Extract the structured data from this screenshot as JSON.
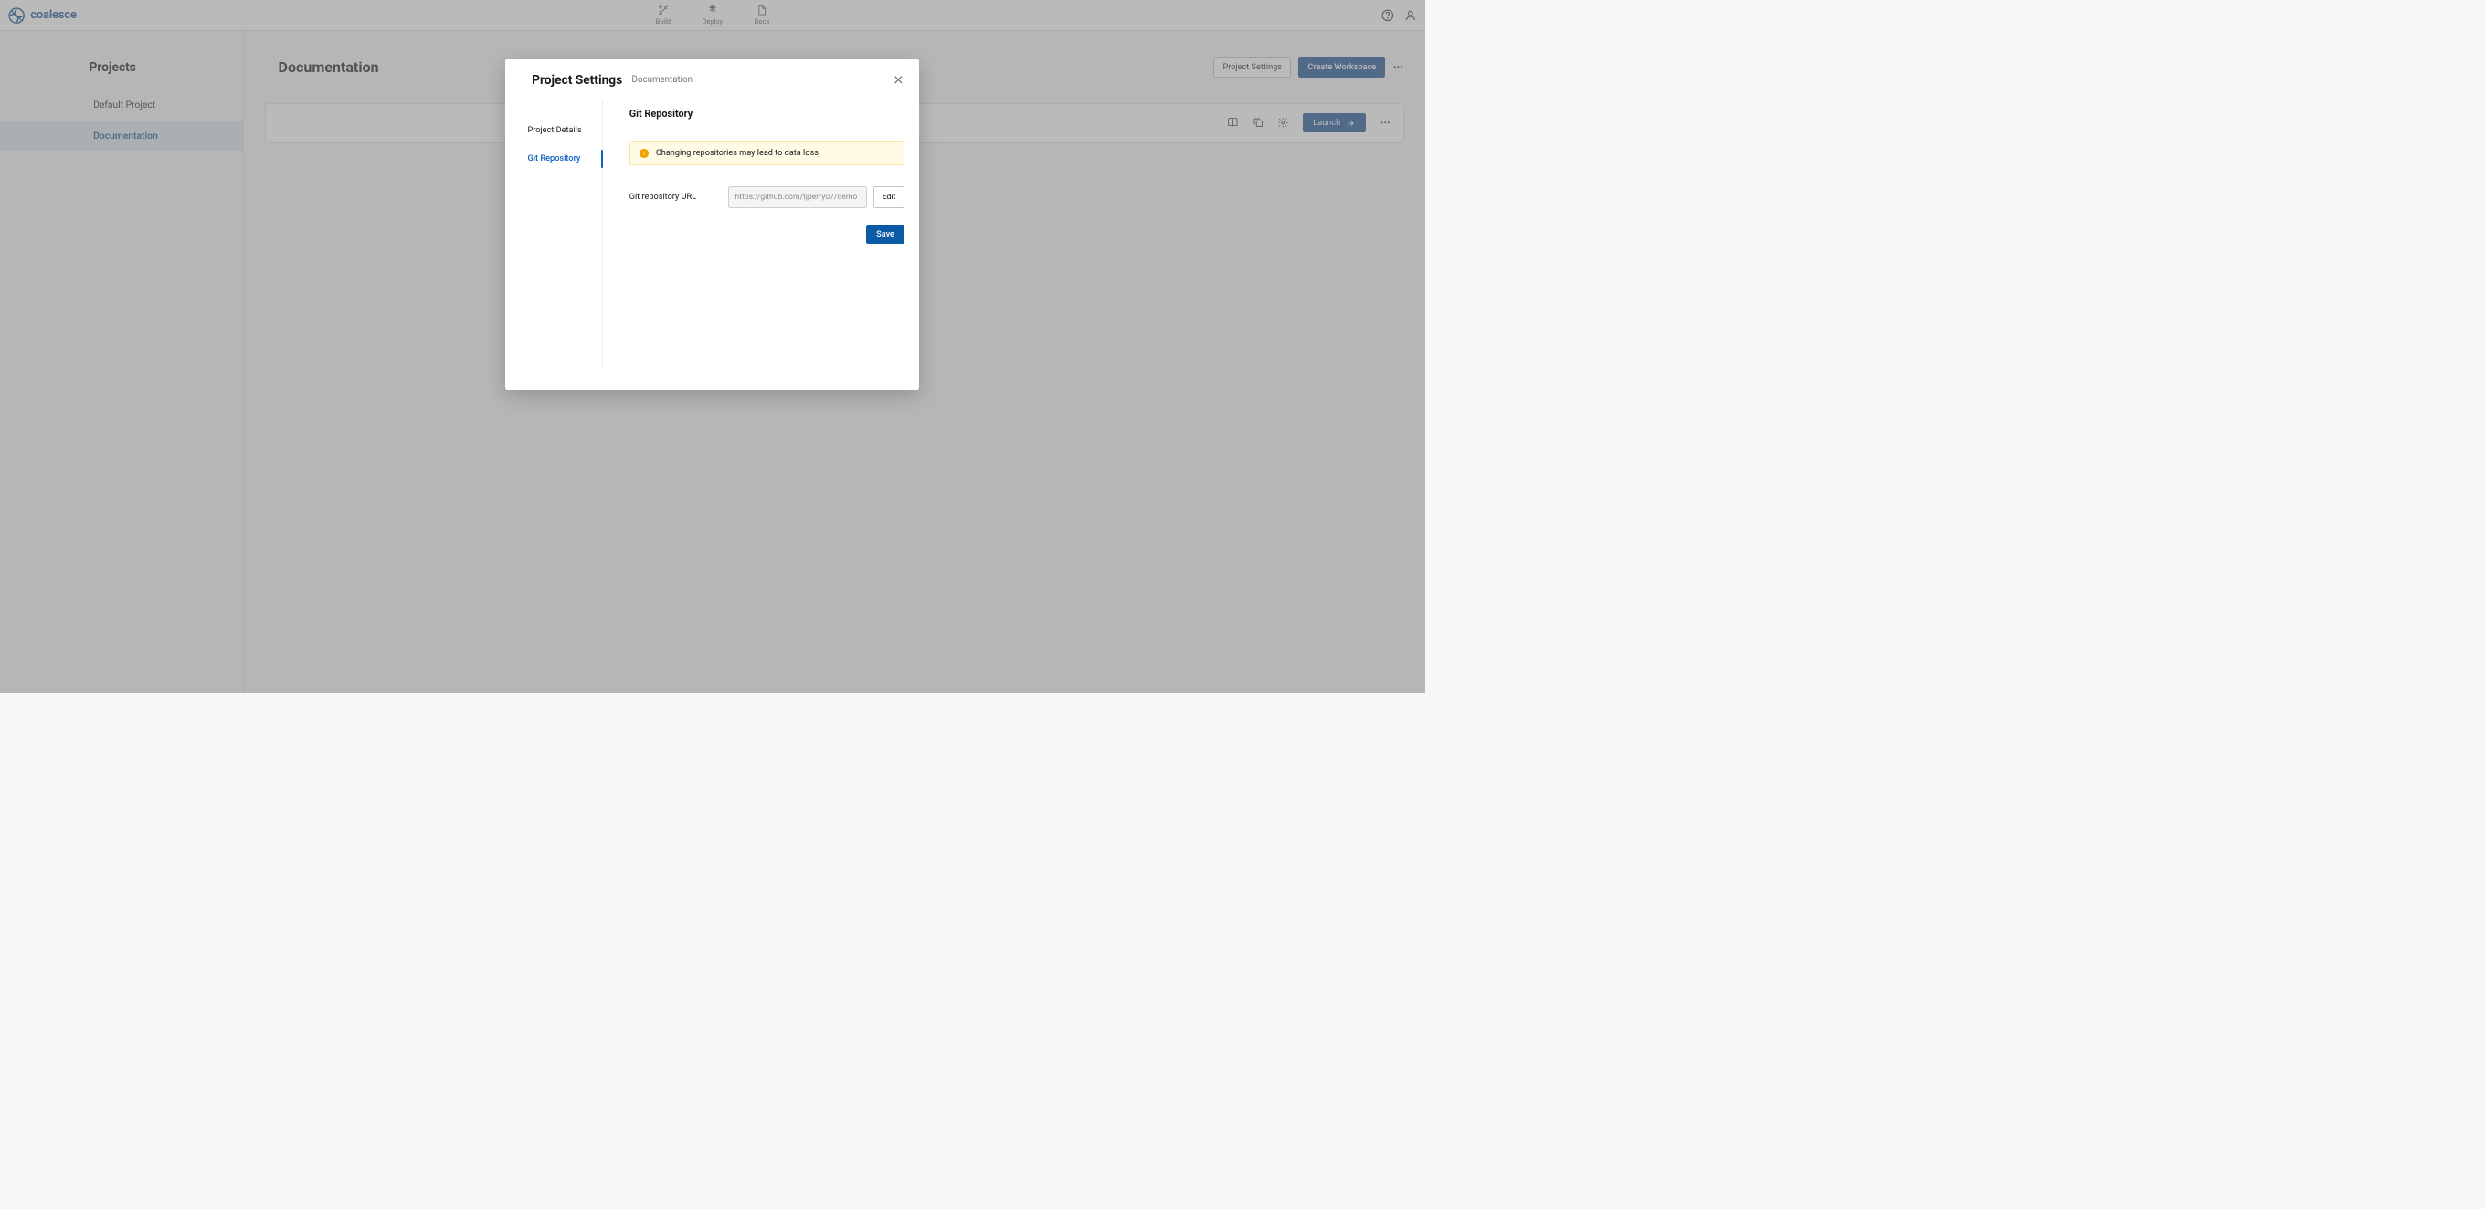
{
  "brand": "coalesce",
  "nav": {
    "build": "Build",
    "deploy": "Deploy",
    "docs": "Docs"
  },
  "sidebar": {
    "title": "Projects",
    "items": [
      {
        "label": "Default Project"
      },
      {
        "label": "Documentation"
      }
    ]
  },
  "content": {
    "title": "Documentation",
    "project_settings_btn": "Project Settings",
    "create_workspace_btn": "Create Workspace",
    "launch_btn": "Launch"
  },
  "modal": {
    "title": "Project Settings",
    "subtitle": "Documentation",
    "tabs": [
      {
        "label": "Project Details"
      },
      {
        "label": "Git Repository"
      }
    ],
    "section_title": "Git Repository",
    "warning": "Changing repositories may lead to data loss",
    "url_label": "Git repository URL",
    "url_value": "https://github.com/tjperry07/demo",
    "edit_btn": "Edit",
    "save_btn": "Save"
  }
}
